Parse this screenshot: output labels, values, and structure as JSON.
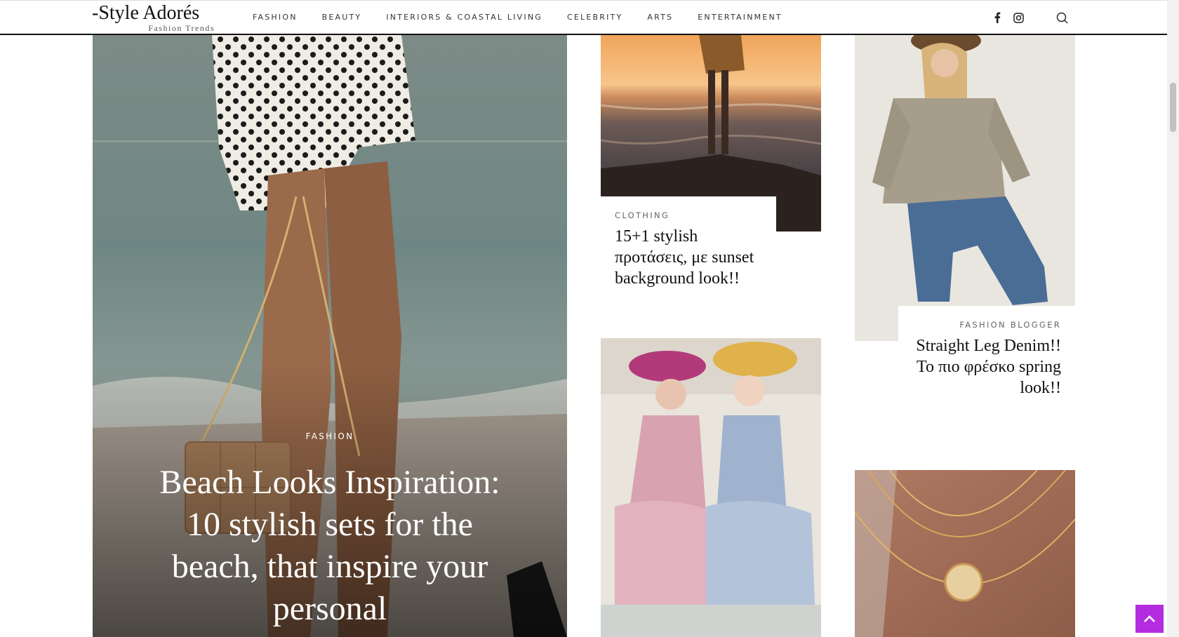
{
  "header": {
    "logo_main": "-Style Adorés",
    "logo_sub": "Fashion Trends",
    "nav": [
      "FASHION",
      "BEAUTY",
      "INTERIORS & COASTAL LIVING",
      "CELEBRITY",
      "ARTS",
      "ENTERTAINMENT"
    ],
    "icons": [
      "facebook-icon",
      "instagram-icon",
      "search-icon"
    ]
  },
  "hero": {
    "category": "FASHION",
    "title": "Beach Looks Inspiration: 10 stylish sets for the beach, that inspire your personal"
  },
  "cards": [
    {
      "category": "CLOTHING",
      "title": "15+1 stylish προτάσεις, με sunset background look!!"
    },
    {
      "category": "FASHION BLOGGER",
      "title": "Straight Leg Denim!! Το πιο φρέσκο spring look!!"
    }
  ],
  "colors": {
    "accent": "#b42ce0",
    "text": "#111111",
    "muted": "#666666"
  },
  "back_to_top_icon": "chevron-up-icon"
}
